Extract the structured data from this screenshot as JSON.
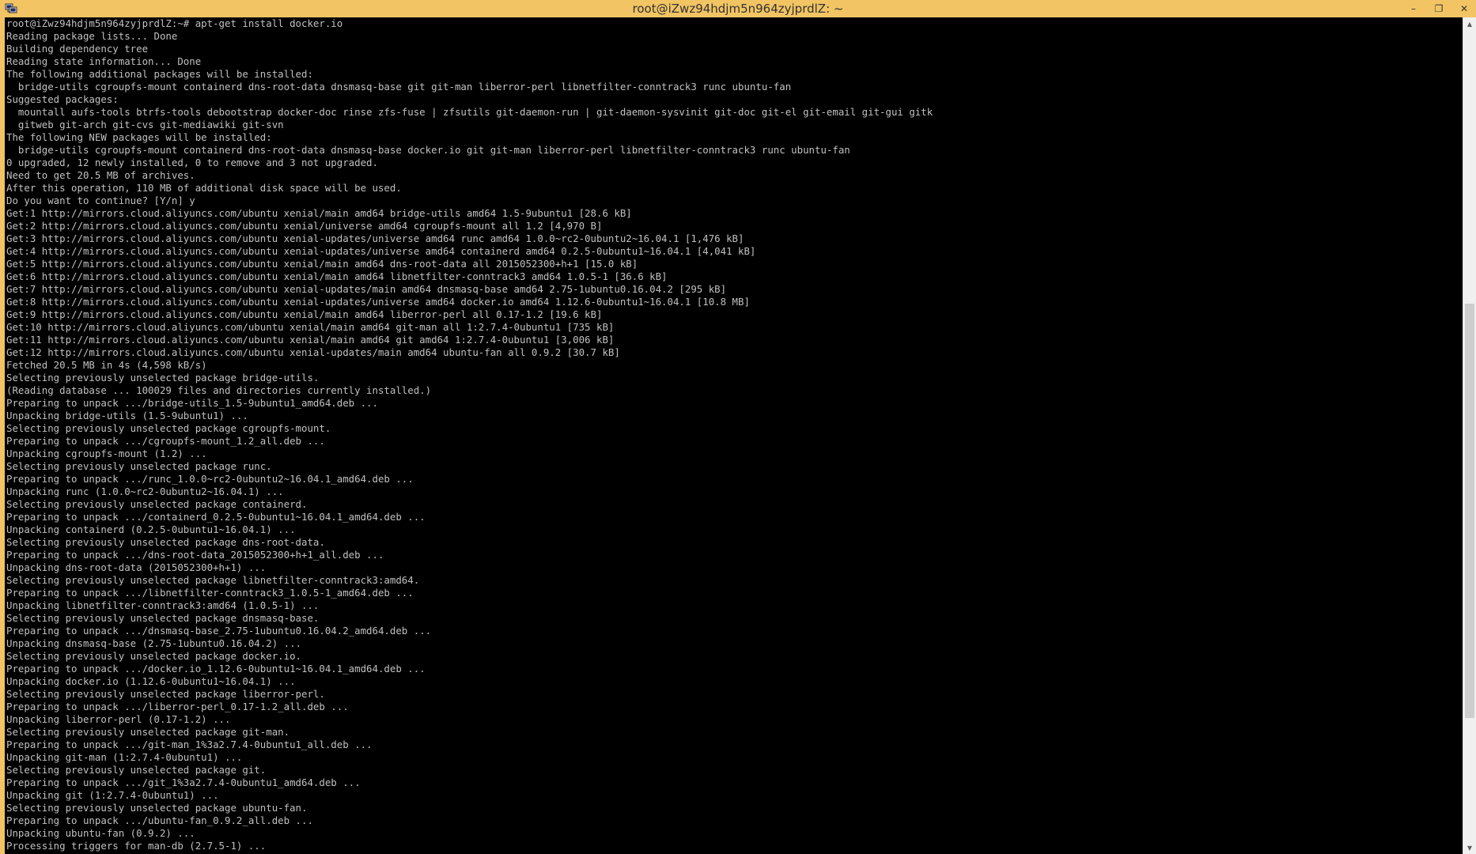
{
  "window": {
    "title": "root@iZwz94hdjm5n964zyjprdlZ: ~",
    "app_icon": "putty-icon",
    "controls": {
      "minimize_glyph": "–",
      "restore_glyph": "❐",
      "close_glyph": "✕"
    }
  },
  "terminal": {
    "lines": [
      "root@iZwz94hdjm5n964zyjprdlZ:~# apt-get install docker.io",
      "Reading package lists... Done",
      "Building dependency tree",
      "Reading state information... Done",
      "The following additional packages will be installed:",
      "  bridge-utils cgroupfs-mount containerd dns-root-data dnsmasq-base git git-man liberror-perl libnetfilter-conntrack3 runc ubuntu-fan",
      "Suggested packages:",
      "  mountall aufs-tools btrfs-tools debootstrap docker-doc rinse zfs-fuse | zfsutils git-daemon-run | git-daemon-sysvinit git-doc git-el git-email git-gui gitk",
      "  gitweb git-arch git-cvs git-mediawiki git-svn",
      "The following NEW packages will be installed:",
      "  bridge-utils cgroupfs-mount containerd dns-root-data dnsmasq-base docker.io git git-man liberror-perl libnetfilter-conntrack3 runc ubuntu-fan",
      "0 upgraded, 12 newly installed, 0 to remove and 3 not upgraded.",
      "Need to get 20.5 MB of archives.",
      "After this operation, 110 MB of additional disk space will be used.",
      "Do you want to continue? [Y/n] y",
      "Get:1 http://mirrors.cloud.aliyuncs.com/ubuntu xenial/main amd64 bridge-utils amd64 1.5-9ubuntu1 [28.6 kB]",
      "Get:2 http://mirrors.cloud.aliyuncs.com/ubuntu xenial/universe amd64 cgroupfs-mount all 1.2 [4,970 B]",
      "Get:3 http://mirrors.cloud.aliyuncs.com/ubuntu xenial-updates/universe amd64 runc amd64 1.0.0~rc2-0ubuntu2~16.04.1 [1,476 kB]",
      "Get:4 http://mirrors.cloud.aliyuncs.com/ubuntu xenial-updates/universe amd64 containerd amd64 0.2.5-0ubuntu1~16.04.1 [4,041 kB]",
      "Get:5 http://mirrors.cloud.aliyuncs.com/ubuntu xenial/main amd64 dns-root-data all 2015052300+h+1 [15.0 kB]",
      "Get:6 http://mirrors.cloud.aliyuncs.com/ubuntu xenial/main amd64 libnetfilter-conntrack3 amd64 1.0.5-1 [36.6 kB]",
      "Get:7 http://mirrors.cloud.aliyuncs.com/ubuntu xenial-updates/main amd64 dnsmasq-base amd64 2.75-1ubuntu0.16.04.2 [295 kB]",
      "Get:8 http://mirrors.cloud.aliyuncs.com/ubuntu xenial-updates/universe amd64 docker.io amd64 1.12.6-0ubuntu1~16.04.1 [10.8 MB]",
      "Get:9 http://mirrors.cloud.aliyuncs.com/ubuntu xenial/main amd64 liberror-perl all 0.17-1.2 [19.6 kB]",
      "Get:10 http://mirrors.cloud.aliyuncs.com/ubuntu xenial/main amd64 git-man all 1:2.7.4-0ubuntu1 [735 kB]",
      "Get:11 http://mirrors.cloud.aliyuncs.com/ubuntu xenial/main amd64 git amd64 1:2.7.4-0ubuntu1 [3,006 kB]",
      "Get:12 http://mirrors.cloud.aliyuncs.com/ubuntu xenial-updates/main amd64 ubuntu-fan all 0.9.2 [30.7 kB]",
      "Fetched 20.5 MB in 4s (4,598 kB/s)",
      "Selecting previously unselected package bridge-utils.",
      "(Reading database ... 100029 files and directories currently installed.)",
      "Preparing to unpack .../bridge-utils_1.5-9ubuntu1_amd64.deb ...",
      "Unpacking bridge-utils (1.5-9ubuntu1) ...",
      "Selecting previously unselected package cgroupfs-mount.",
      "Preparing to unpack .../cgroupfs-mount_1.2_all.deb ...",
      "Unpacking cgroupfs-mount (1.2) ...",
      "Selecting previously unselected package runc.",
      "Preparing to unpack .../runc_1.0.0~rc2-0ubuntu2~16.04.1_amd64.deb ...",
      "Unpacking runc (1.0.0~rc2-0ubuntu2~16.04.1) ...",
      "Selecting previously unselected package containerd.",
      "Preparing to unpack .../containerd_0.2.5-0ubuntu1~16.04.1_amd64.deb ...",
      "Unpacking containerd (0.2.5-0ubuntu1~16.04.1) ...",
      "Selecting previously unselected package dns-root-data.",
      "Preparing to unpack .../dns-root-data_2015052300+h+1_all.deb ...",
      "Unpacking dns-root-data (2015052300+h+1) ...",
      "Selecting previously unselected package libnetfilter-conntrack3:amd64.",
      "Preparing to unpack .../libnetfilter-conntrack3_1.0.5-1_amd64.deb ...",
      "Unpacking libnetfilter-conntrack3:amd64 (1.0.5-1) ...",
      "Selecting previously unselected package dnsmasq-base.",
      "Preparing to unpack .../dnsmasq-base_2.75-1ubuntu0.16.04.2_amd64.deb ...",
      "Unpacking dnsmasq-base (2.75-1ubuntu0.16.04.2) ...",
      "Selecting previously unselected package docker.io.",
      "Preparing to unpack .../docker.io_1.12.6-0ubuntu1~16.04.1_amd64.deb ...",
      "Unpacking docker.io (1.12.6-0ubuntu1~16.04.1) ...",
      "Selecting previously unselected package liberror-perl.",
      "Preparing to unpack .../liberror-perl_0.17-1.2_all.deb ...",
      "Unpacking liberror-perl (0.17-1.2) ...",
      "Selecting previously unselected package git-man.",
      "Preparing to unpack .../git-man_1%3a2.7.4-0ubuntu1_all.deb ...",
      "Unpacking git-man (1:2.7.4-0ubuntu1) ...",
      "Selecting previously unselected package git.",
      "Preparing to unpack .../git_1%3a2.7.4-0ubuntu1_amd64.deb ...",
      "Unpacking git (1:2.7.4-0ubuntu1) ...",
      "Selecting previously unselected package ubuntu-fan.",
      "Preparing to unpack .../ubuntu-fan_0.9.2_all.deb ...",
      "Unpacking ubuntu-fan (0.9.2) ...",
      "Processing triggers for man-db (2.7.5-1) ..."
    ]
  },
  "scrollbar": {
    "up_arrow_glyph": "▲",
    "down_arrow_glyph": "▼"
  }
}
